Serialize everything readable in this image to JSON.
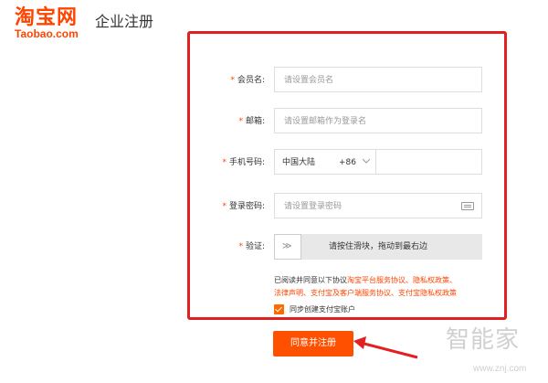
{
  "header": {
    "logo_cn": "淘宝网",
    "logo_en": "Taobao.com",
    "title": "企业注册"
  },
  "form": {
    "required_mark": "*",
    "member_name": {
      "label": "会员名:",
      "placeholder": "请设置会员名"
    },
    "email": {
      "label": "邮箱:",
      "placeholder": "请设置邮箱作为登录名"
    },
    "phone": {
      "label": "手机号码:",
      "country": "中国大陆",
      "code": "+86"
    },
    "password": {
      "label": "登录密码:",
      "placeholder": "请设置登录密码"
    },
    "verify": {
      "label": "验证:",
      "handle": "≫",
      "hint": "请按住滑块，拖动到最右边"
    },
    "agreement": {
      "prefix": "已阅读并同意以下协议",
      "links": [
        "淘宝平台服务协议、",
        "隐私权政策、",
        "法律声明、",
        "支付宝及客户端服务协议、",
        "支付宝隐私权政策"
      ]
    },
    "alipay_checkbox": {
      "label": "同步创建支付宝账户",
      "checked": true
    },
    "submit_label": "同意并注册"
  },
  "watermark": {
    "text": "智能家",
    "url": "www.znj.com"
  },
  "colors": {
    "brand": "#ff4400",
    "highlight_border": "#e41f1f",
    "button": "#ff5000"
  }
}
